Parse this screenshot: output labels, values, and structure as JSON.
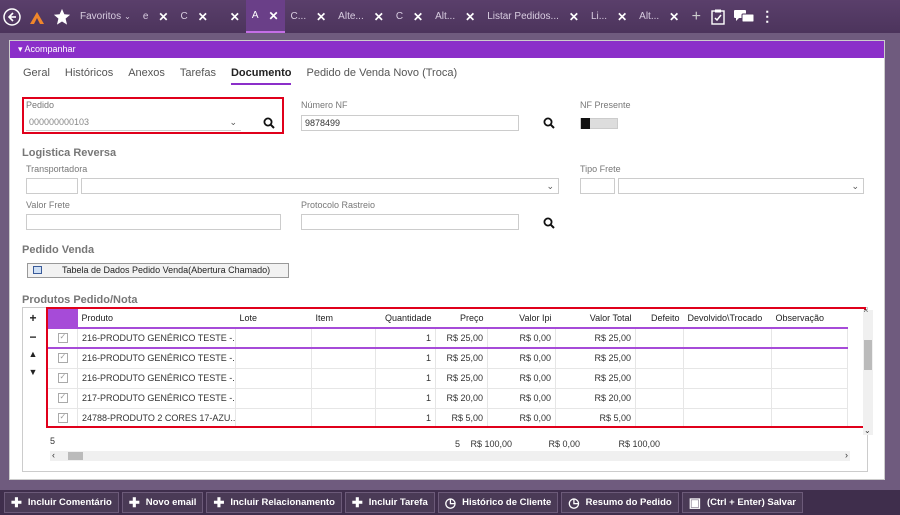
{
  "topbar": {
    "favorites_label": "Favoritos",
    "tabs": [
      {
        "label": "e",
        "active": false
      },
      {
        "label": "C",
        "active": false
      },
      {
        "label": "",
        "active": false
      },
      {
        "label": "A",
        "active": true
      },
      {
        "label": "C...",
        "active": false
      },
      {
        "label": "Alte...",
        "active": false
      },
      {
        "label": "C",
        "active": false
      },
      {
        "label": "Alt...",
        "active": false
      },
      {
        "label": "Listar Pedidos...",
        "active": false
      },
      {
        "label": "Li...",
        "active": false
      },
      {
        "label": "Alt...",
        "active": false
      }
    ],
    "close_glyph": "✕"
  },
  "section": {
    "title": "Acompanhar"
  },
  "tabs": [
    "Geral",
    "Históricos",
    "Anexos",
    "Tarefas",
    "Documento",
    "Pedido de Venda Novo (Troca)"
  ],
  "active_tab": "Documento",
  "form": {
    "pedido_label": "Pedido",
    "pedido_value": "000000000103",
    "numero_nf_label": "Número NF",
    "numero_nf_value": "9878499",
    "nf_presente_label": "NF Presente",
    "logistica_title": "Logistica Reversa",
    "transportadora_label": "Transportadora",
    "tipo_frete_label": "Tipo Frete",
    "valor_frete_label": "Valor Frete",
    "protocolo_label": "Protocolo Rastreio",
    "pedido_venda_title": "Pedido Venda",
    "tabela_button": "Tabela de Dados Pedido Venda(Abertura Chamado)",
    "produtos_title": "Produtos Pedido/Nota"
  },
  "grid": {
    "headers": [
      "Produto",
      "Lote",
      "Item",
      "Quantidade",
      "Preço",
      "Valor Ipi",
      "Valor Total",
      "Defeito",
      "Devolvido\\Trocado",
      "Observação"
    ],
    "rows": [
      [
        "216-PRODUTO GENÉRICO TESTE -...",
        "",
        "",
        "1",
        "R$ 25,00",
        "R$ 0,00",
        "R$ 25,00",
        "",
        "",
        ""
      ],
      [
        "216-PRODUTO GENÉRICO TESTE -...",
        "",
        "",
        "1",
        "R$ 25,00",
        "R$ 0,00",
        "R$ 25,00",
        "",
        "",
        ""
      ],
      [
        "216-PRODUTO GENÉRICO TESTE -...",
        "",
        "",
        "1",
        "R$ 25,00",
        "R$ 0,00",
        "R$ 25,00",
        "",
        "",
        ""
      ],
      [
        "217-PRODUTO GENÉRICO TESTE -...",
        "",
        "",
        "1",
        "R$ 20,00",
        "R$ 0,00",
        "R$ 20,00",
        "",
        "",
        ""
      ],
      [
        "24788-PRODUTO 2 CORES 17-AZU...",
        "",
        "",
        "1",
        "R$ 5,00",
        "R$ 0,00",
        "R$ 5,00",
        "",
        "",
        ""
      ]
    ],
    "totals": {
      "count": "5",
      "quantidade": "5",
      "preco": "R$ 100,00",
      "ipi": "R$ 0,00",
      "total": "R$ 100,00"
    }
  },
  "bottombar": [
    {
      "label": "Incluir Comentário",
      "icon": "plus-icon"
    },
    {
      "label": "Novo email",
      "icon": "plus-icon"
    },
    {
      "label": "Incluir Relacionamento",
      "icon": "plus-icon"
    },
    {
      "label": "Incluir Tarefa",
      "icon": "plus-icon"
    },
    {
      "label": "Histórico de Cliente",
      "icon": "history-icon"
    },
    {
      "label": "Resumo do Pedido",
      "icon": "history-icon"
    },
    {
      "label": "(Ctrl + Enter) Salvar",
      "icon": "save-icon"
    }
  ],
  "colors": {
    "accent": "#8b2fc9",
    "highlight_border": "#e0001b",
    "topbar": "#4c345c"
  }
}
